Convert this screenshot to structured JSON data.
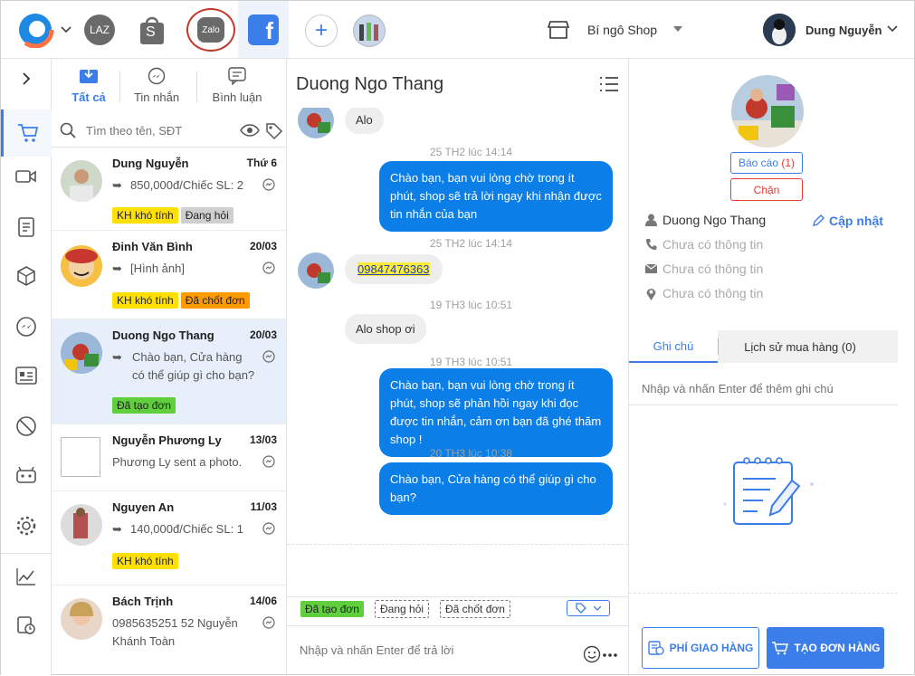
{
  "topbar": {
    "channels": {
      "lazada": "LAZ",
      "shopee": "S",
      "zalo": "Zalo",
      "facebook": "f"
    },
    "shop_name": "Bí ngô Shop",
    "user_name": "Dung Nguyễn"
  },
  "filter_tabs": [
    {
      "label": "Tất cả"
    },
    {
      "label": "Tin nhắn"
    },
    {
      "label": "Bình luận"
    }
  ],
  "search": {
    "placeholder": "Tìm theo tên, SĐT"
  },
  "conversations": [
    {
      "name": "Dung Nguyễn",
      "date": "Thứ 6",
      "preview": "850,000đ/Chiếc SL: 2",
      "tags": [
        "KH khó tính",
        "Đang hỏi"
      ]
    },
    {
      "name": "Đinh Văn Bình",
      "date": "20/03",
      "preview": "[Hình ảnh]",
      "tags": [
        "KH khó tính",
        "Đã chốt đơn"
      ]
    },
    {
      "name": "Duong Ngo Thang",
      "date": "20/03",
      "preview": "Chào bạn, Cửa hàng có thể giúp gì cho bạn?",
      "tags": [
        "Đã tạo đơn"
      ]
    },
    {
      "name": "Nguyễn Phương Ly",
      "date": "13/03",
      "preview": "Phương Ly sent a photo.",
      "tags": []
    },
    {
      "name": "Nguyen An",
      "date": "11/03",
      "preview": "140,000đ/Chiếc SL: 1",
      "tags": [
        "KH khó tính"
      ]
    },
    {
      "name": "Bách Trịnh",
      "date": "14/06",
      "preview": "0985635251 52 Nguyễn Khánh Toàn",
      "tags": []
    }
  ],
  "chat": {
    "title": "Duong Ngo Thang",
    "messages": [
      {
        "text": "Alo"
      },
      {
        "time": "25 TH2 lúc 14:14"
      },
      {
        "text": "Chào bạn, bạn vui lòng chờ  trong ít phút, shop sẽ trả lời ngay khi nhận được tin nhắn của bạn"
      },
      {
        "time": "25 TH2 lúc 14:14"
      },
      {
        "text": "09847476363"
      },
      {
        "time": "19 TH3 lúc 10:51"
      },
      {
        "text": "Alo shop ơi"
      },
      {
        "time": "19 TH3 lúc 10:51"
      },
      {
        "text": "Chào bạn, bạn vui lòng chờ trong ít phút, shop sẽ phản hồi ngay khi đọc được tin nhắn, cảm ơn bạn đã ghé thăm shop !"
      },
      {
        "time": "20 TH3 lúc 10:38"
      },
      {
        "text": "Chào bạn, Cửa hàng có thể giúp gì cho bạn?"
      }
    ],
    "quick_tags": [
      "Đã tạo đơn",
      "Đang hỏi",
      "Đã chốt đơn"
    ],
    "input_placeholder": "Nhập và nhấn Enter để trả lời"
  },
  "customer": {
    "report_label": "Báo cáo",
    "report_count": "(1)",
    "block_label": "Chặn",
    "name": "Duong Ngo Thang",
    "update_label": "Cập nhật",
    "phone": "Chưa có thông tin",
    "email": "Chưa có thông tin",
    "address": "Chưa có thông tin"
  },
  "notes": {
    "tab_notes": "Ghi chú",
    "tab_history": "Lịch sử mua hàng (0)",
    "placeholder": "Nhập và nhấn Enter để thêm ghi chú"
  },
  "actions": {
    "shipping": "PHÍ GIAO HÀNG",
    "create_order": "TẠO ĐƠN HÀNG"
  },
  "colors": {
    "accent": "#3b7de9",
    "bubble": "#0b7ee8",
    "danger": "#e53935",
    "tag_yellow": "#ffe000",
    "tag_green": "#5fcf3d",
    "tag_orange": "#ff9a00"
  }
}
